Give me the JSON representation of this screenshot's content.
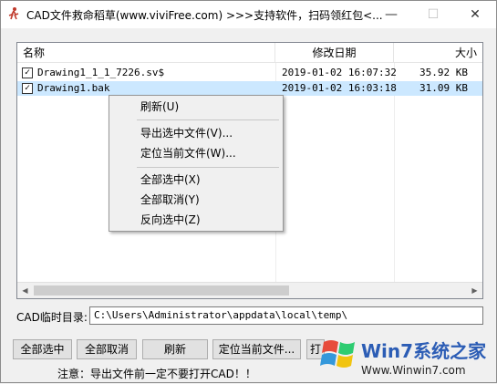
{
  "window": {
    "title": "CAD文件救命稻草(www.viviFree.com) >>>支持软件，扫码领红包<...",
    "min_glyph": "—",
    "max_glyph": "☐",
    "close_glyph": "✕",
    "app_icon": "person-running-icon"
  },
  "list": {
    "columns": [
      "名称",
      "修改日期",
      "大小"
    ],
    "rows": [
      {
        "checked": true,
        "check_glyph": "✓",
        "name": "Drawing1_1_1_7226.sv$",
        "date": "2019-01-02 16:07:32",
        "size": "35.92 KB",
        "selected": false
      },
      {
        "checked": true,
        "check_glyph": "✓",
        "name": "Drawing1.bak",
        "date": "2019-01-02 16:03:18",
        "size": "31.09 KB",
        "selected": true
      }
    ],
    "scroll_left_glyph": "◀",
    "scroll_right_glyph": "▶"
  },
  "context_menu": {
    "items": [
      "刷新(U)",
      "导出选中文件(V)...",
      "定位当前文件(W)...",
      "全部选中(X)",
      "全部取消(Y)",
      "反向选中(Z)"
    ]
  },
  "directory": {
    "label": "CAD临时目录:",
    "value": "C:\\Users\\Administrator\\appdata\\local\\temp\\"
  },
  "buttons": {
    "select_all": "全部选中",
    "deselect_all": "全部取消",
    "refresh": "刷新",
    "locate_file": "定位当前文件...",
    "partial": "打"
  },
  "notice": "注意：导出文件前一定不要打开CAD！！",
  "watermark": {
    "brand": "Win7系统之家",
    "url": "Www.Winwin7.com"
  },
  "colors": {
    "selection": "#cce8ff",
    "watermark_brand": "#2c5db5"
  }
}
